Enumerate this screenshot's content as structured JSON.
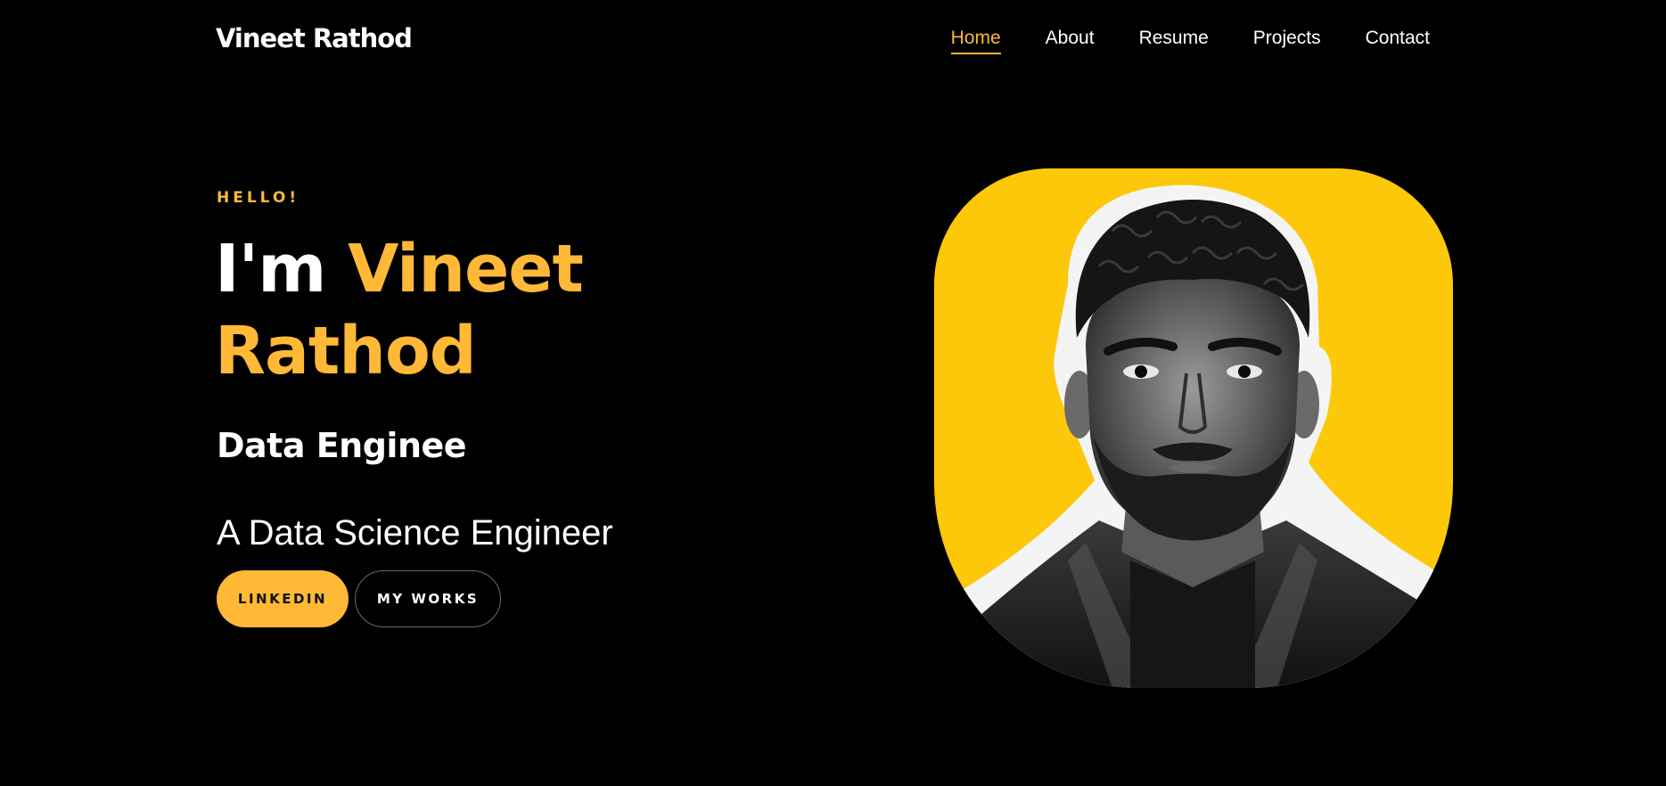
{
  "header": {
    "brand": "Vineet Rathod",
    "nav": [
      {
        "label": "Home",
        "active": true
      },
      {
        "label": "About",
        "active": false
      },
      {
        "label": "Resume",
        "active": false
      },
      {
        "label": "Projects",
        "active": false
      },
      {
        "label": "Contact",
        "active": false
      }
    ]
  },
  "hero": {
    "greeting": "HELLO!",
    "intro": "I'm",
    "name_first": "Vineet",
    "name_last": "Rathod",
    "role": "Data Enginee",
    "subtitle": "A Data Science Engineer",
    "buttons": {
      "primary": "LINKEDIN",
      "secondary": "MY WORKS"
    }
  },
  "colors": {
    "background": "#000000",
    "accent": "#ffb936",
    "portrait_bg": "#fdc80a"
  }
}
